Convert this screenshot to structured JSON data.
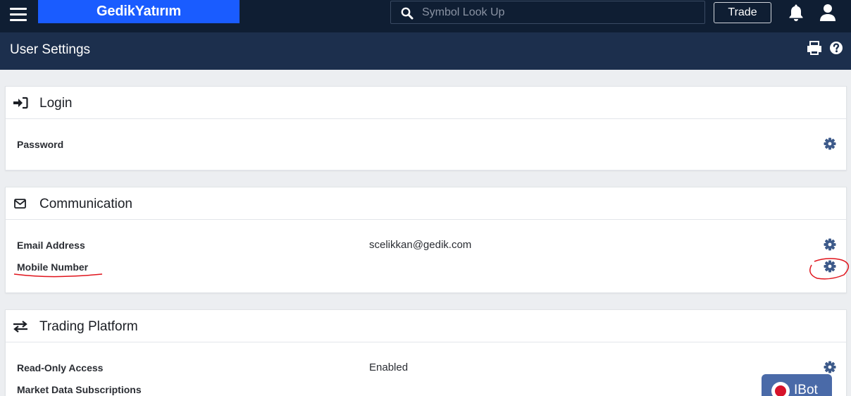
{
  "topbar": {
    "logo": "GedikYatırım",
    "search_placeholder": "Symbol Look Up",
    "trade_label": "Trade"
  },
  "page": {
    "title": "User Settings"
  },
  "sections": [
    {
      "title": "Login",
      "icon": "sign-in-icon",
      "rows": [
        {
          "label": "Password",
          "value": ""
        }
      ]
    },
    {
      "title": "Communication",
      "icon": "envelope-icon",
      "rows": [
        {
          "label": "Email Address",
          "value": "scelikkan@gedik.com"
        },
        {
          "label": "Mobile Number",
          "value": ""
        }
      ]
    },
    {
      "title": "Trading Platform",
      "icon": "exchange-arrows-icon",
      "rows": [
        {
          "label": "Read-Only Access",
          "value": "Enabled"
        },
        {
          "label": "Market Data Subscriptions",
          "value": ""
        }
      ]
    }
  ],
  "ibot": {
    "label": "IBot"
  },
  "colors": {
    "topbar": "#0f1e33",
    "subheader": "#1c2f4d",
    "logo_bg": "#1a5cff",
    "gear": "#3d5a8a",
    "annotation": "#e0141c"
  }
}
